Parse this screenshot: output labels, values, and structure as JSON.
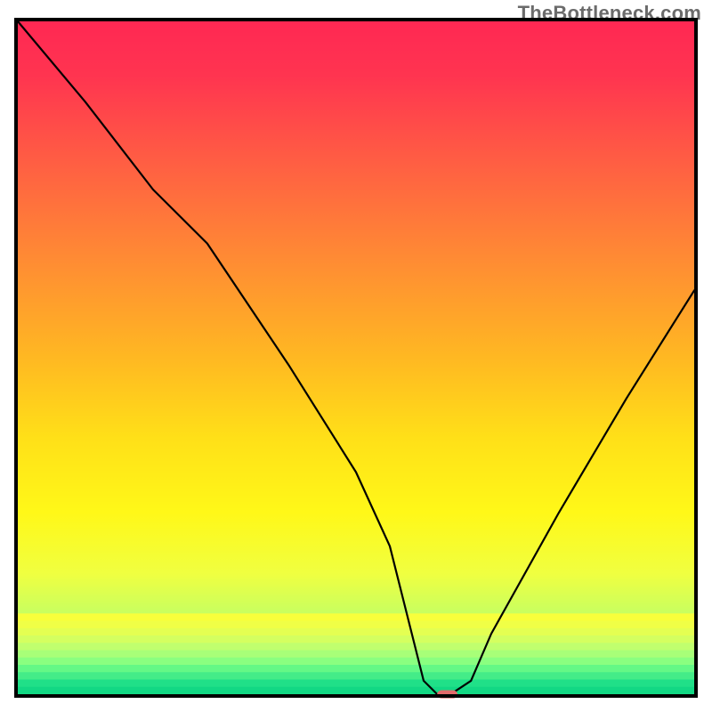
{
  "watermark": "TheBottleneck.com",
  "chart_data": {
    "type": "line",
    "title": "",
    "xlabel": "",
    "ylabel": "",
    "xlim": [
      0,
      100
    ],
    "ylim": [
      0,
      100
    ],
    "series": [
      {
        "name": "bottleneck-curve",
        "x": [
          0,
          10,
          20,
          28,
          40,
          50,
          55,
          58,
          60,
          62,
          64,
          67,
          70,
          80,
          90,
          100
        ],
        "y": [
          100,
          88,
          75,
          67,
          49,
          33,
          22,
          10,
          2,
          0,
          0,
          2,
          9,
          27,
          44,
          60
        ]
      }
    ],
    "marker": {
      "name": "optimal-point",
      "x": 63.5,
      "y": 0,
      "color": "#e36a6a",
      "width": 3,
      "height": 1.2
    },
    "gradient_stops": [
      {
        "pct": 0,
        "color": "#ff2853"
      },
      {
        "pct": 8,
        "color": "#ff3450"
      },
      {
        "pct": 20,
        "color": "#ff5b44"
      },
      {
        "pct": 35,
        "color": "#ff8a34"
      },
      {
        "pct": 50,
        "color": "#ffb822"
      },
      {
        "pct": 62,
        "color": "#ffe018"
      },
      {
        "pct": 73,
        "color": "#fff818"
      },
      {
        "pct": 82,
        "color": "#f0ff40"
      },
      {
        "pct": 88,
        "color": "#c8ff60"
      },
      {
        "pct": 93,
        "color": "#7aff80"
      },
      {
        "pct": 98,
        "color": "#20e88a"
      },
      {
        "pct": 100,
        "color": "#12d884"
      }
    ],
    "bottom_band_colors": [
      "#f8ff3c",
      "#f0ff46",
      "#e4ff52",
      "#d4ff60",
      "#c0ff6e",
      "#a8ff78",
      "#8aff80",
      "#64f886",
      "#44ec88",
      "#20e088",
      "#12d884"
    ]
  }
}
